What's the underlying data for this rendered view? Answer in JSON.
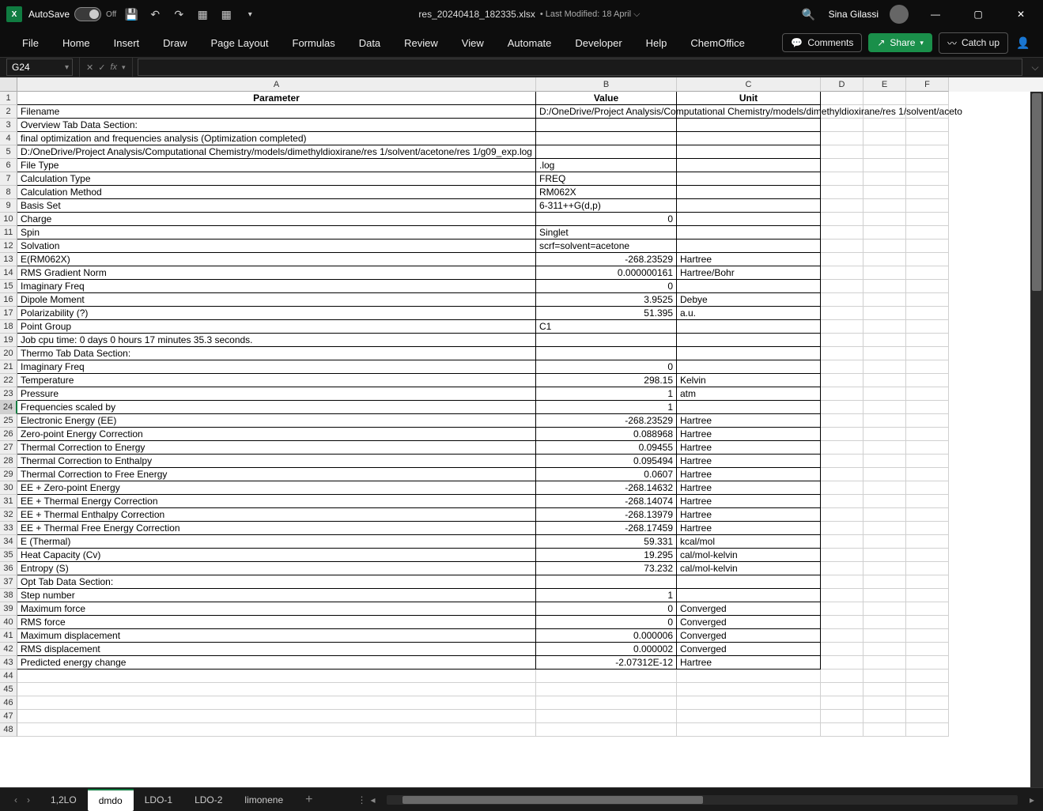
{
  "title": {
    "filename": "res_20240418_182335.xlsx",
    "modified": "Last Modified: 18 April",
    "autosave_label": "AutoSave",
    "autosave_state": "Off",
    "user": "Sina Gilassi"
  },
  "ribbon": {
    "tabs": [
      "File",
      "Home",
      "Insert",
      "Draw",
      "Page Layout",
      "Formulas",
      "Data",
      "Review",
      "View",
      "Automate",
      "Developer",
      "Help",
      "ChemOffice"
    ],
    "comments": "Comments",
    "share": "Share",
    "catchup": "Catch up"
  },
  "namebox": "G24",
  "fx": "fx",
  "columns": [
    {
      "letter": "A",
      "label": "Parameter",
      "class": "colA"
    },
    {
      "letter": "B",
      "label": "Value",
      "class": "colB"
    },
    {
      "letter": "C",
      "label": "Unit",
      "class": "colC"
    },
    {
      "letter": "D",
      "label": "",
      "class": "colD"
    },
    {
      "letter": "E",
      "label": "",
      "class": "colE"
    },
    {
      "letter": "F",
      "label": "",
      "class": "colF"
    }
  ],
  "rows": [
    {
      "n": 2,
      "a": "Filename",
      "b": "D:/OneDrive/Project Analysis/Computational Chemistry/models/dimethyldioxirane/res 1/solvent/aceto",
      "c": "",
      "bOverflow": true
    },
    {
      "n": 3,
      "a": "Overview Tab Data Section:",
      "b": "",
      "c": ""
    },
    {
      "n": 4,
      "a": "final optimization and frequencies analysis (Optimization completed)",
      "b": "",
      "c": ""
    },
    {
      "n": 5,
      "a": "D:/OneDrive/Project Analysis/Computational Chemistry/models/dimethyldioxirane/res 1/solvent/acetone/res 1/g09_exp.log",
      "b": "",
      "c": ""
    },
    {
      "n": 6,
      "a": "File Type",
      "b": ".log",
      "c": ""
    },
    {
      "n": 7,
      "a": "Calculation Type",
      "b": "FREQ",
      "c": ""
    },
    {
      "n": 8,
      "a": "Calculation Method",
      "b": "RM062X",
      "c": ""
    },
    {
      "n": 9,
      "a": "Basis Set",
      "b": "6-311++G(d,p)",
      "c": ""
    },
    {
      "n": 10,
      "a": "Charge",
      "b": "0",
      "c": "",
      "r": true
    },
    {
      "n": 11,
      "a": "Spin",
      "b": "Singlet",
      "c": ""
    },
    {
      "n": 12,
      "a": "Solvation",
      "b": "scrf=solvent=acetone",
      "c": ""
    },
    {
      "n": 13,
      "a": "E(RM062X)",
      "b": "-268.23529",
      "c": "Hartree",
      "r": true
    },
    {
      "n": 14,
      "a": "RMS Gradient Norm",
      "b": "0.000000161",
      "c": "Hartree/Bohr",
      "r": true
    },
    {
      "n": 15,
      "a": "Imaginary Freq",
      "b": "0",
      "c": "",
      "r": true
    },
    {
      "n": 16,
      "a": "Dipole Moment",
      "b": "3.9525",
      "c": "Debye",
      "r": true
    },
    {
      "n": 17,
      "a": "Polarizability (?)",
      "b": "51.395",
      "c": "a.u.",
      "r": true
    },
    {
      "n": 18,
      "a": "Point Group",
      "b": "C1",
      "c": ""
    },
    {
      "n": 19,
      "a": "Job cpu time:       0 days  0 hours 17 minutes 35.3 seconds.",
      "b": "",
      "c": ""
    },
    {
      "n": 20,
      "a": "Thermo Tab Data Section:",
      "b": "",
      "c": ""
    },
    {
      "n": 21,
      "a": "Imaginary Freq",
      "b": "0",
      "c": "",
      "r": true
    },
    {
      "n": 22,
      "a": "Temperature",
      "b": "298.15",
      "c": "Kelvin",
      "r": true
    },
    {
      "n": 23,
      "a": "Pressure",
      "b": "1",
      "c": "atm",
      "r": true
    },
    {
      "n": 24,
      "a": "Frequencies scaled by",
      "b": "1",
      "c": "",
      "r": true,
      "sel": true
    },
    {
      "n": 25,
      "a": "Electronic Energy (EE)",
      "b": "-268.23529",
      "c": "Hartree",
      "r": true
    },
    {
      "n": 26,
      "a": "Zero-point Energy Correction",
      "b": "0.088968",
      "c": "Hartree",
      "r": true
    },
    {
      "n": 27,
      "a": "Thermal Correction to Energy",
      "b": "0.09455",
      "c": "Hartree",
      "r": true
    },
    {
      "n": 28,
      "a": "Thermal Correction to Enthalpy",
      "b": "0.095494",
      "c": "Hartree",
      "r": true
    },
    {
      "n": 29,
      "a": "Thermal Correction to Free Energy",
      "b": "0.0607",
      "c": "Hartree",
      "r": true
    },
    {
      "n": 30,
      "a": "EE + Zero-point Energy",
      "b": "-268.14632",
      "c": "Hartree",
      "r": true
    },
    {
      "n": 31,
      "a": "EE + Thermal Energy Correction",
      "b": "-268.14074",
      "c": "Hartree",
      "r": true
    },
    {
      "n": 32,
      "a": "EE + Thermal Enthalpy Correction",
      "b": "-268.13979",
      "c": "Hartree",
      "r": true
    },
    {
      "n": 33,
      "a": "EE + Thermal Free Energy Correction",
      "b": "-268.17459",
      "c": "Hartree",
      "r": true
    },
    {
      "n": 34,
      "a": "E (Thermal)",
      "b": "59.331",
      "c": "kcal/mol",
      "r": true
    },
    {
      "n": 35,
      "a": "Heat Capacity (Cv)",
      "b": "19.295",
      "c": "cal/mol-kelvin",
      "r": true
    },
    {
      "n": 36,
      "a": "Entropy (S)",
      "b": "73.232",
      "c": "cal/mol-kelvin",
      "r": true
    },
    {
      "n": 37,
      "a": "Opt Tab Data Section:",
      "b": "",
      "c": ""
    },
    {
      "n": 38,
      "a": "Step number",
      "b": "1",
      "c": "",
      "r": true
    },
    {
      "n": 39,
      "a": "Maximum force",
      "b": "0",
      "c": "Converged",
      "r": true
    },
    {
      "n": 40,
      "a": "RMS force",
      "b": "0",
      "c": "Converged",
      "r": true
    },
    {
      "n": 41,
      "a": "Maximum displacement",
      "b": "0.000006",
      "c": "Converged",
      "r": true
    },
    {
      "n": 42,
      "a": "RMS displacement",
      "b": "0.000002",
      "c": "Converged",
      "r": true
    },
    {
      "n": 43,
      "a": "Predicted energy change",
      "b": "-2.07312E-12",
      "c": "Hartree",
      "r": true
    },
    {
      "n": 44,
      "a": "",
      "b": "",
      "c": "",
      "plain": true
    },
    {
      "n": 45,
      "a": "",
      "b": "",
      "c": "",
      "plain": true
    },
    {
      "n": 46,
      "a": "",
      "b": "",
      "c": "",
      "plain": true
    },
    {
      "n": 47,
      "a": "",
      "b": "",
      "c": "",
      "plain": true
    },
    {
      "n": 48,
      "a": "",
      "b": "",
      "c": "",
      "plain": true
    }
  ],
  "sheetTabs": [
    "1,2LO",
    "dmdo",
    "LDO-1",
    "LDO-2",
    "limonene"
  ],
  "activeSheet": 1
}
